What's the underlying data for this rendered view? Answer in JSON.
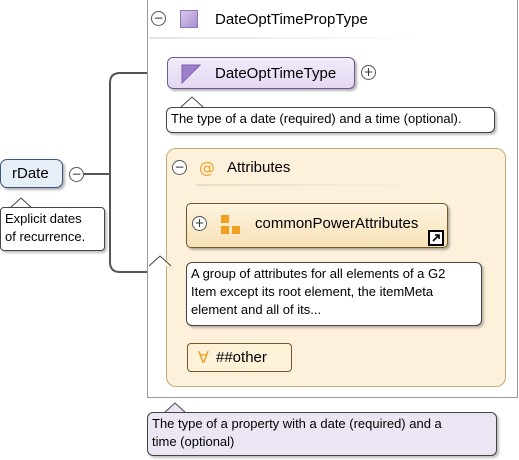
{
  "root": {
    "name": "rDate",
    "collapse_symbol": "−",
    "annotation": [
      "Explicit dates",
      "of recurrence."
    ]
  },
  "complex_type": {
    "name": "DateOptTimePropType",
    "collapse_symbol": "−",
    "annotation": [
      "The type of a property with a date (required) and a",
      "time (optional)"
    ]
  },
  "simple_content": {
    "name": "DateOptTimeType",
    "expand_symbol": "+",
    "annotation": [
      "The type of a date (required) and a time (optional)."
    ]
  },
  "attributes": {
    "label": "Attributes",
    "icon_symbol": "@",
    "collapse_symbol": "−",
    "group": {
      "name": "commonPowerAttributes",
      "expand_symbol": "+",
      "annotation": [
        "A group of attributes for all elements of a G2",
        "Item except its root element, the itemMeta",
        "element and all of its..."
      ]
    },
    "wildcard": {
      "symbol": "∀",
      "label": "##other"
    }
  },
  "colors": {
    "element_fill": "#e6eef8",
    "element_border": "#3a5680",
    "type_accent": "#9d7fcc",
    "attribute_accent": "#f0a020",
    "attribute_fill": "#fdf1dc"
  }
}
